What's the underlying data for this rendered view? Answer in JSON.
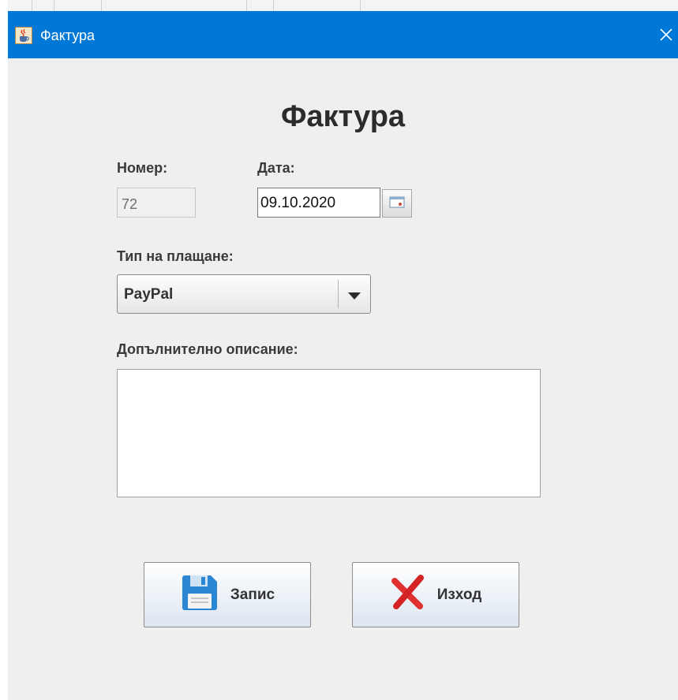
{
  "window": {
    "title": "Фактура",
    "titlebar_color": "#0078d7",
    "app_icon": "java-cup-icon",
    "close_icon": "close-icon"
  },
  "form": {
    "heading": "Фактура",
    "number": {
      "label": "Номер:",
      "value": "72"
    },
    "date": {
      "label": "Дата:",
      "value": "09.10.2020",
      "picker_icon": "calendar-icon"
    },
    "payment_type": {
      "label": "Тип на плащане:",
      "selected": "PayPal",
      "dropdown_icon": "chevron-down-icon"
    },
    "description": {
      "label": "Допълнително описание:",
      "value": ""
    }
  },
  "buttons": {
    "save": {
      "label": "Запис",
      "icon": "floppy-disk-icon"
    },
    "exit": {
      "label": "Изход",
      "icon": "red-x-icon"
    }
  }
}
